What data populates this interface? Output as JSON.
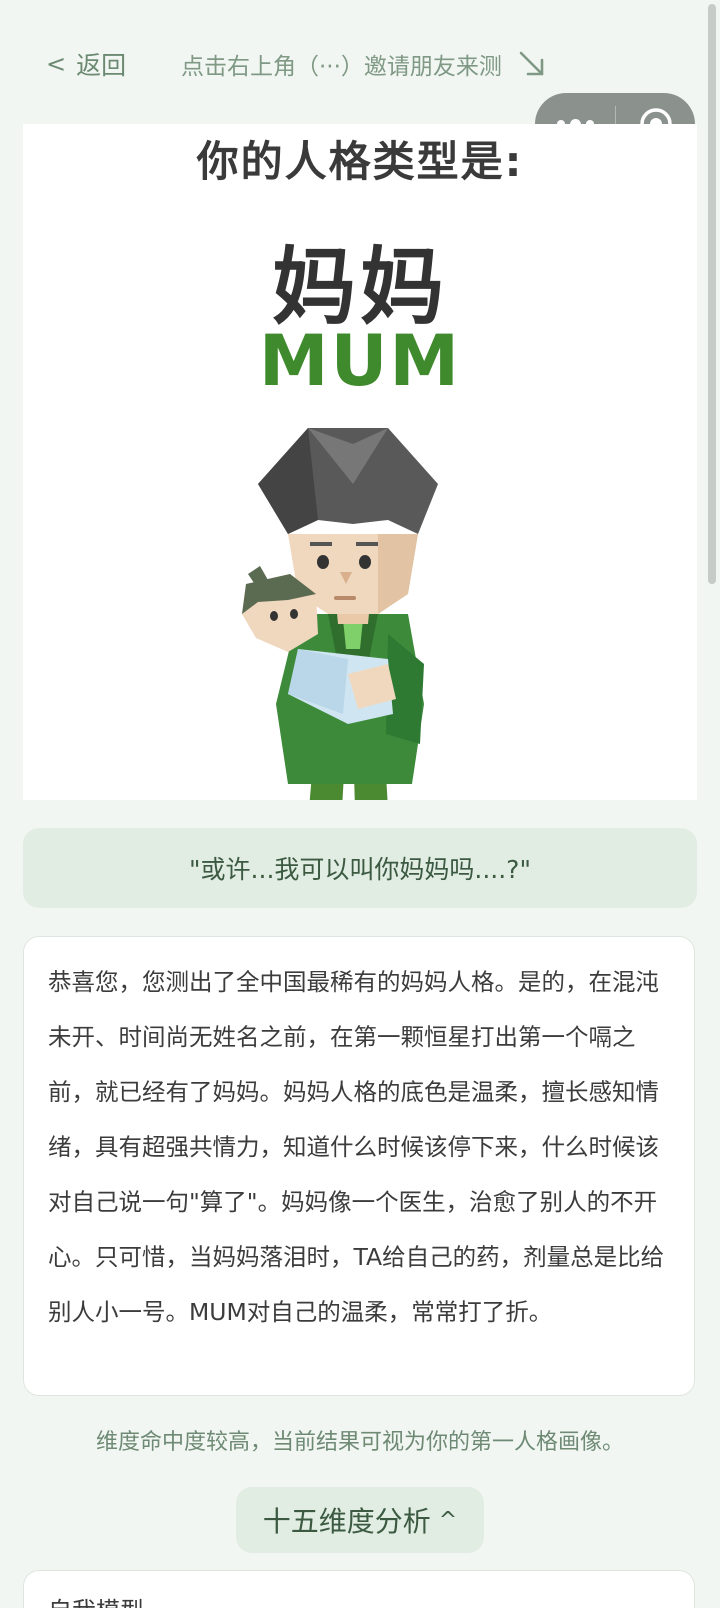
{
  "topbar": {
    "back_icon": "<",
    "back_label": "返回",
    "share_hint": "点击右上角（···）邀请朋友来测",
    "hint_arrow_icon": "arrow-down-right-icon"
  },
  "capsule": {
    "more_icon": "more-dots-icon",
    "close_icon": "target-circle-icon"
  },
  "result": {
    "heading": "你的人格类型是:",
    "type_cn": "妈妈",
    "type_en": "MUM",
    "illustration": "mum-holding-baby-illustration",
    "accent_color": "#3f8a2c"
  },
  "quote": "\"或许...我可以叫你妈妈吗....?\"",
  "description": "恭喜您，您测出了全中国最稀有的妈妈人格。是的，在混沌未开、时间尚无姓名之前，在第一颗恒星打出第一个嗝之前，就已经有了妈妈。妈妈人格的底色是温柔，擅长感知情绪，具有超强共情力，知道什么时候该停下来，什么时候该对自己说一句\"算了\"。妈妈像一个医生，治愈了别人的不开心。只可惜，当妈妈落泪时，TA给自己的药，剂量总是比给别人小一号。MUM对自己的温柔，常常打了折。",
  "note": "维度命中度较高，当前结果可视为你的第一人格画像。",
  "analysis_toggle": {
    "label": "十五维度分析",
    "caret": "^"
  },
  "next_section": {
    "title": "自我模型"
  },
  "colors": {
    "page_bg": "#f1f6f2",
    "soft_green": "#e1ede2",
    "muted_green_text": "#6c8a72"
  }
}
